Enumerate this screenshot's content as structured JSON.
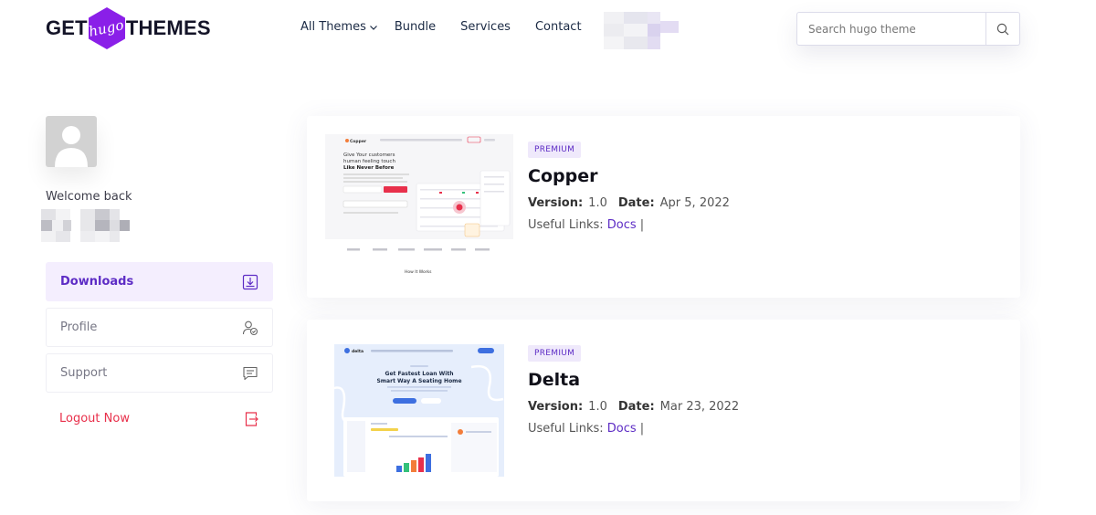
{
  "header": {
    "logo": {
      "left": "GET",
      "center": "hugo",
      "right": "THEMES"
    },
    "nav": [
      {
        "label": "All Themes",
        "has_dropdown": true
      },
      {
        "label": "Bundle"
      },
      {
        "label": "Services"
      },
      {
        "label": "Contact"
      }
    ],
    "search": {
      "placeholder": "Search hugo theme",
      "value": ""
    }
  },
  "sidebar": {
    "welcome": "Welcome back",
    "menu": [
      {
        "label": "Downloads",
        "icon": "download-icon",
        "active": true
      },
      {
        "label": "Profile",
        "icon": "profile-icon"
      },
      {
        "label": "Support",
        "icon": "chat-icon"
      },
      {
        "label": "Logout Now",
        "icon": "logout-icon"
      }
    ]
  },
  "themes": [
    {
      "badge": "PREMIUM",
      "name": "Copper",
      "version_label": "Version:",
      "version": "1.0",
      "date_label": "Date:",
      "date": "Apr 5, 2022",
      "links_label": "Useful Links:",
      "link": "Docs",
      "separator": "|",
      "preview": {
        "brand": "Copper",
        "headline": [
          "Give Your customers",
          "human feeling touch",
          "Like Never Before"
        ],
        "section": "How It Works"
      }
    },
    {
      "badge": "PREMIUM",
      "name": "Delta",
      "version_label": "Version:",
      "version": "1.0",
      "date_label": "Date:",
      "date": "Mar 23, 2022",
      "links_label": "Useful Links:",
      "link": "Docs",
      "separator": "|",
      "preview": {
        "brand": "delta",
        "headline": [
          "Get Fastest Loan With",
          "Smart Way A Seating Home"
        ]
      }
    }
  ],
  "colors": {
    "accent": "#5d2cc5",
    "logo_hex": "#8a1fe8",
    "active_bg": "#f4eefe",
    "logout": "#e8304b"
  }
}
